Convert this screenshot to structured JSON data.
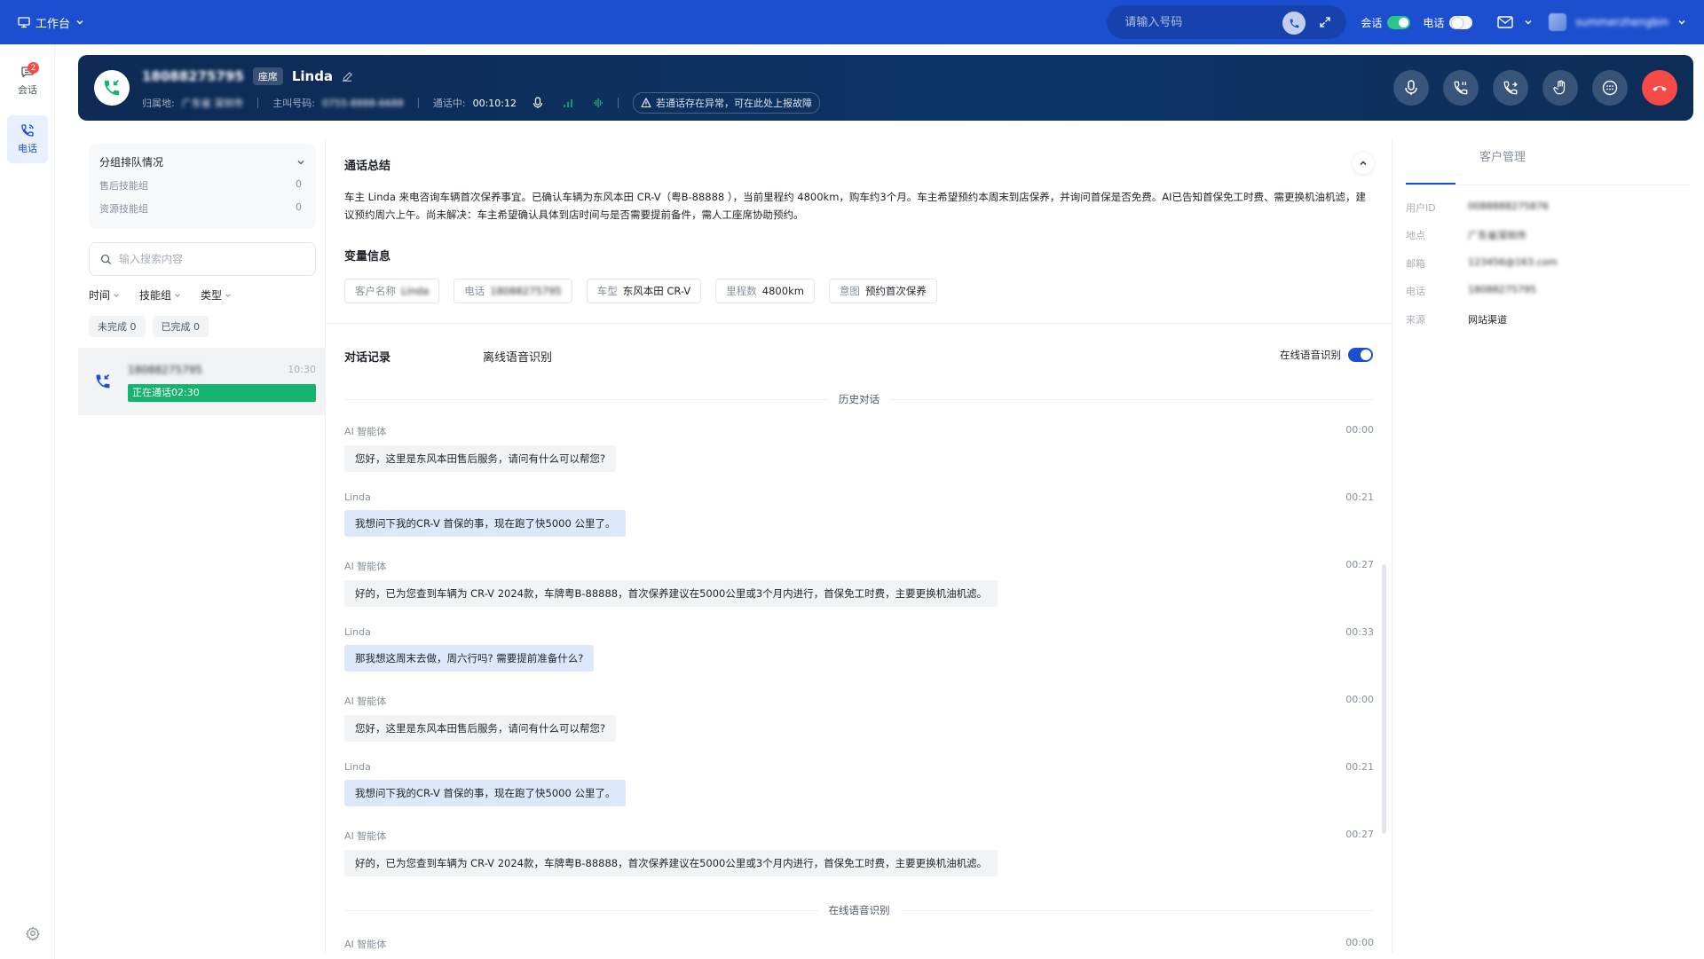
{
  "topbar": {
    "workspace_label": "工作台",
    "search_placeholder": "请输入号码",
    "chat_toggle_label": "会话",
    "phone_toggle_label": "电话",
    "user_name": "summerzhengbin"
  },
  "nav": {
    "chat_label": "会话",
    "chat_badge": "2",
    "phone_label": "电话"
  },
  "call": {
    "number": "18088275795",
    "seat_tag": "座席",
    "customer_name": "Linda",
    "location_label": "归属地:",
    "location_value": "广东省 深圳市",
    "caller_label": "主叫号码:",
    "caller_value": "0755-8888-6688",
    "status_label": "通话中:",
    "duration": "00:10:12",
    "report_hint": "若通话存在异常，可在此处上报故障"
  },
  "queue": {
    "title": "分组排队情况",
    "rows": [
      {
        "name": "售后技能组",
        "count": "0"
      },
      {
        "name": "资源技能组",
        "count": "0"
      }
    ]
  },
  "search": {
    "placeholder": "输入搜索内容"
  },
  "filters": [
    {
      "label": "时间"
    },
    {
      "label": "技能组"
    },
    {
      "label": "类型"
    }
  ],
  "chips": {
    "unfinished": "未完成 0",
    "finished": "已完成 0"
  },
  "session": {
    "number": "18088275795",
    "time": "10:30",
    "status": "正在通话02:30"
  },
  "summary": {
    "title": "通话总结",
    "text": "车主 Linda 来电咨询车辆首次保养事宜。已确认车辆为东风本田 CR-V（粤B-88888 ），当前里程约 4800km，购车约3个月。车主希望预约本周末到店保养，并询问首保是否免费。AI已告知首保免工时费、需更换机油机滤，建议预约周六上午。尚未解决：车主希望确认具体到店时间与是否需要提前备件，需人工座席协助预约。"
  },
  "variables": {
    "title": "变量信息",
    "items": [
      {
        "key": "客户名称",
        "value": "Linda"
      },
      {
        "key": "电话",
        "value": "18088275795"
      },
      {
        "key": "车型",
        "value": "东风本田 CR-V"
      },
      {
        "key": "里程数",
        "value": "4800km"
      },
      {
        "key": "意图",
        "value": "预约首次保养"
      }
    ]
  },
  "dialog": {
    "tab_records": "对话记录",
    "tab_offline": "离线语音识别",
    "online_asr_label": "在线语音识别",
    "history_label": "历史对话",
    "online_divider_label": "在线语音识别",
    "messages": [
      {
        "speaker": "AI 智能体",
        "time": "00:00",
        "text": "您好，这里是东风本田售后服务，请问有什么可以帮您?"
      },
      {
        "speaker": "Linda",
        "time": "00:21",
        "text": "我想问下我的CR-V 首保的事，现在跑了快5000 公里了。"
      },
      {
        "speaker": "AI 智能体",
        "time": "00:27",
        "text": "好的，已为您查到车辆为 CR-V 2024款，车牌粤B-88888，首次保养建议在5000公里或3个月内进行，首保免工时费，主要更换机油机滤。"
      },
      {
        "speaker": "Linda",
        "time": "00:33",
        "text": "那我想这周末去做，周六行吗? 需要提前准备什么?"
      },
      {
        "speaker": "AI 智能体",
        "time": "00:00",
        "text": "您好，这里是东风本田售后服务，请问有什么可以帮您?"
      },
      {
        "speaker": "Linda",
        "time": "00:21",
        "text": "我想问下我的CR-V 首保的事，现在跑了快5000 公里了。"
      },
      {
        "speaker": "AI 智能体",
        "time": "00:27",
        "text": "好的，已为您查到车辆为 CR-V 2024款，车牌粤B-88888，首次保养建议在5000公里或3个月内进行，首保免工时费，主要更换机油机滤。"
      }
    ],
    "last_speaker": "AI 智能体",
    "last_time": "00:00"
  },
  "customer": {
    "title": "客户管理",
    "fields": [
      {
        "key": "用户ID",
        "value": "0088888275876"
      },
      {
        "key": "地点",
        "value": "广东省深圳市"
      },
      {
        "key": "邮箱",
        "value": "123456@163.com"
      },
      {
        "key": "电话",
        "value": "18088275795"
      },
      {
        "key": "来源",
        "value": "网站渠道"
      }
    ]
  },
  "colors": {
    "brand": "#1c4fd0",
    "callbar": "#0c3567",
    "success": "#14b46e",
    "hangup": "#f54a45"
  }
}
